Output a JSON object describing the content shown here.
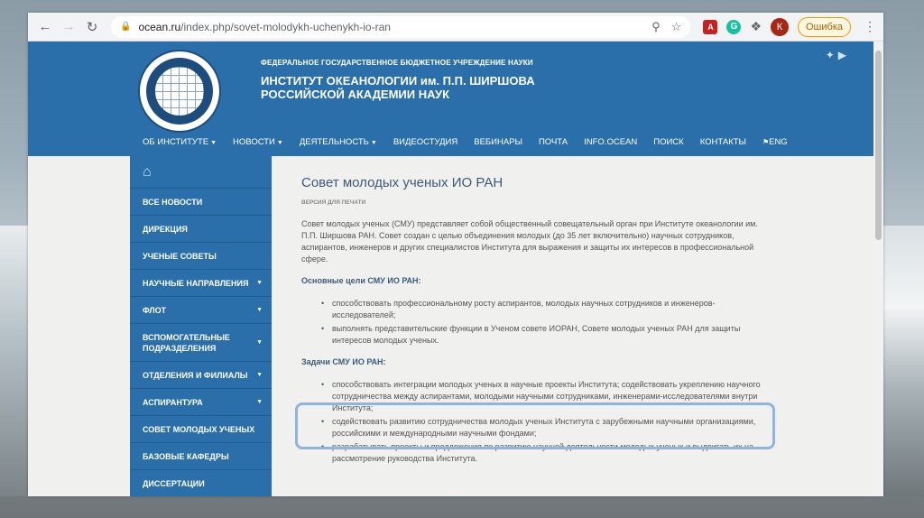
{
  "browser": {
    "url_host": "ocean.ru",
    "url_path": "/index.php/sovet-molodykh-uchenykh-io-ran",
    "profile_initial": "К",
    "error_label": "Ошибка"
  },
  "header": {
    "org_small": "ФЕДЕРАЛЬНОЕ ГОСУДАРСТВЕННОЕ БЮДЖЕТНОЕ УЧРЕЖДЕНИЕ НАУКИ",
    "org_line1": "ИНСТИТУТ ОКЕАНОЛОГИИ им. П.П. ШИРШОВА",
    "org_line2": "РОССИЙСКОЙ АКАДЕМИИ НАУК"
  },
  "nav": [
    {
      "label": "ОБ ИНСТИТУТЕ",
      "dropdown": true
    },
    {
      "label": "НОВОСТИ",
      "dropdown": true
    },
    {
      "label": "ДЕЯТЕЛЬНОСТЬ",
      "dropdown": true
    },
    {
      "label": "ВИДЕОСТУДИЯ",
      "dropdown": false
    },
    {
      "label": "ВЕБИНАРЫ",
      "dropdown": false
    },
    {
      "label": "ПОЧТА",
      "dropdown": false
    },
    {
      "label": "INFO.OCEAN",
      "dropdown": false
    },
    {
      "label": "ПОИСК",
      "dropdown": false
    },
    {
      "label": "КОНТАКТЫ",
      "dropdown": false
    },
    {
      "label": "ENG",
      "dropdown": false
    }
  ],
  "sidebar": {
    "items": [
      {
        "label": "ВСЕ НОВОСТИ"
      },
      {
        "label": "ДИРЕКЦИЯ"
      },
      {
        "label": "УЧЕНЫЕ СОВЕТЫ"
      },
      {
        "label": "НАУЧНЫЕ НАПРАВЛЕНИЯ"
      },
      {
        "label": "ФЛОТ"
      },
      {
        "label": "ВСПОМОГАТЕЛЬНЫЕ ПОДРАЗДЕЛЕНИЯ"
      },
      {
        "label": "ОТДЕЛЕНИЯ И ФИЛИАЛЫ"
      },
      {
        "label": "АСПИРАНТУРА"
      },
      {
        "label": "СОВЕТ МОЛОДЫХ УЧЕНЫХ"
      },
      {
        "label": "БАЗОВЫЕ КАФЕДРЫ"
      },
      {
        "label": "ДИССЕРТАЦИИ"
      }
    ]
  },
  "content": {
    "title": "Совет молодых ученых ИО РАН",
    "print_link": "ВЕРСИЯ ДЛЯ ПЕЧАТИ",
    "intro": "Совет молодых ученых (СМУ) представляет собой общественный совещательный орган при Институте океанологии им. П.П. Ширшова РАН. Совет создан с целью объединения молодых (до 35 лет включительно) научных сотрудников, аспирантов, инженеров и других специалистов Института для выражения и защиты их интересов в профессиональной сфере.",
    "goals_head": "Основные цели СМУ ИО РАН:",
    "goals": [
      "способствовать профессиональному росту аспирантов, молодых научных сотрудников и инженеров-исследователей;",
      "выполнять представительские функции в Ученом совете ИОРАН, Совете молодых ученых РАН для защиты интересов молодых ученых."
    ],
    "tasks_head": "Задачи СМУ ИО РАН:",
    "tasks": [
      "способствовать интеграции молодых ученых в научные проекты Института; содействовать укреплению научного сотрудничества между аспирантами, молодыми научными сотрудниками, инженерами-исследователями внутри Института;",
      "содействовать развитию сотрудничества молодых ученых Института с зарубежными научными организациями, российскими и международными научными фондами;",
      "разрабатывать проекты и предложения по развитию научной деятельности молодых ученых и выдвигать их на рассмотрение руководства Института."
    ]
  }
}
